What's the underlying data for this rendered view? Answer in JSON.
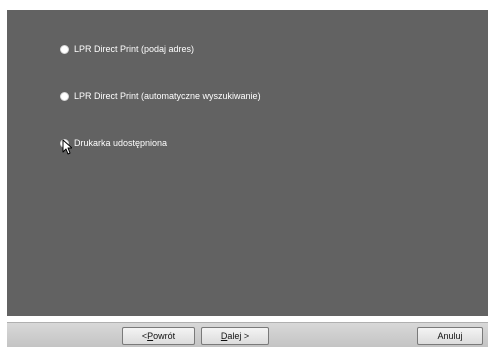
{
  "options": [
    {
      "label": "LPR Direct Print (podaj adres)",
      "checked": false
    },
    {
      "label": "LPR Direct Print (automatyczne wyszukiwanie)",
      "checked": false
    },
    {
      "label": "Drukarka udostępniona",
      "checked": true
    }
  ],
  "footer": {
    "back_prefix": "< ",
    "back_mnemonic": "P",
    "back_rest": "owrót",
    "next_mnemonic": "D",
    "next_rest": "alej >",
    "cancel_label": "Anuluj"
  },
  "colors": {
    "panel_bg": "#626262",
    "text": "#ffffff",
    "footer_bg": "#d0d0d0"
  },
  "icons": {
    "cursor": "arrow-pointer-icon"
  }
}
